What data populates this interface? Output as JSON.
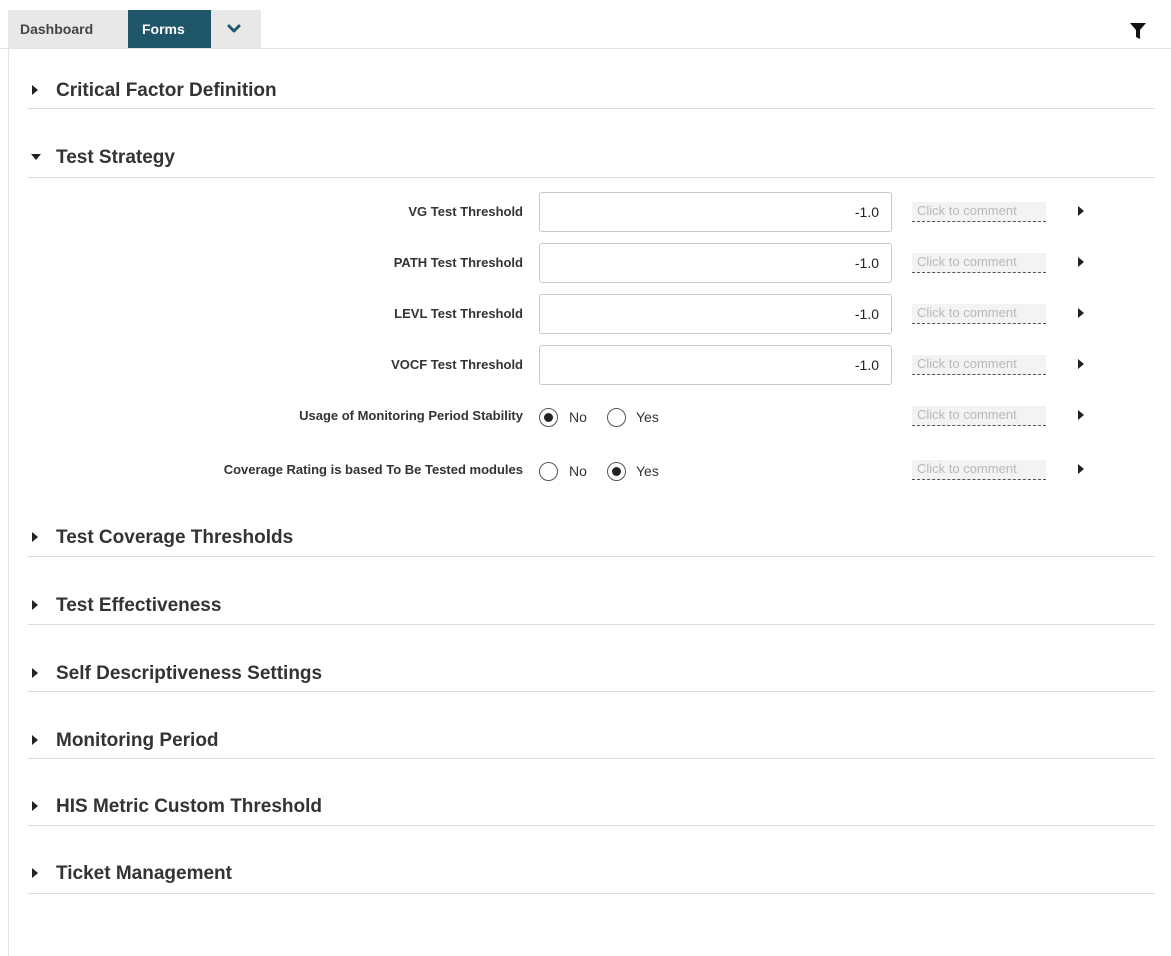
{
  "tabs": {
    "dashboard": "Dashboard",
    "forms": "Forms"
  },
  "icons": {
    "more": "chevron-down-icon",
    "filter": "filter-icon",
    "collapsed": "caret-right-icon",
    "expanded": "caret-down-icon"
  },
  "colors": {
    "active_tab": "#1f5669",
    "inactive_tab": "#e8e8e8"
  },
  "sections": {
    "critical_factor": "Critical Factor Definition",
    "test_strategy": "Test Strategy",
    "test_coverage": "Test Coverage Thresholds",
    "test_effectiveness": "Test Effectiveness",
    "self_descriptiveness": "Self Descriptiveness Settings",
    "monitoring_period": "Monitoring Period",
    "his_metric": "HIS Metric Custom Threshold",
    "ticket_management": "Ticket Management"
  },
  "test_strategy": {
    "fields": [
      {
        "label": "VG Test Threshold",
        "value": "-1.0",
        "comment": "Click to comment"
      },
      {
        "label": "PATH Test Threshold",
        "value": "-1.0",
        "comment": "Click to comment"
      },
      {
        "label": "LEVL Test Threshold",
        "value": "-1.0",
        "comment": "Click to comment"
      },
      {
        "label": "VOCF Test Threshold",
        "value": "-1.0",
        "comment": "Click to comment"
      }
    ],
    "radios": [
      {
        "label": "Usage of Monitoring Period Stability",
        "no": "No",
        "yes": "Yes",
        "selected": "No",
        "comment": "Click to comment"
      },
      {
        "label": "Coverage Rating is based To Be Tested modules",
        "no": "No",
        "yes": "Yes",
        "selected": "Yes",
        "comment": "Click to comment"
      }
    ]
  }
}
